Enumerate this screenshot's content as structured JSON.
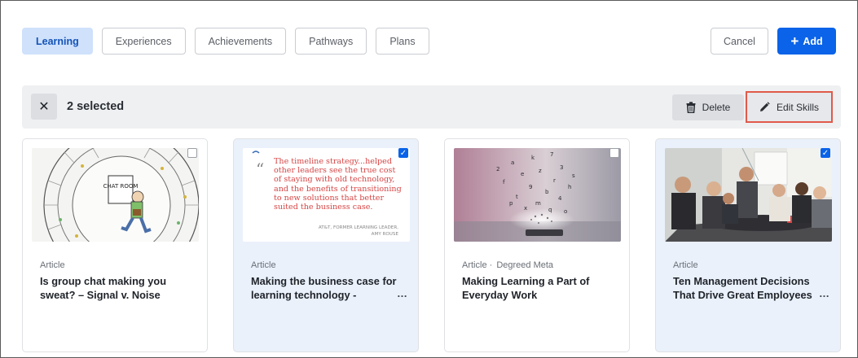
{
  "tabs": [
    {
      "label": "Learning",
      "active": true
    },
    {
      "label": "Experiences",
      "active": false
    },
    {
      "label": "Achievements",
      "active": false
    },
    {
      "label": "Pathways",
      "active": false
    },
    {
      "label": "Plans",
      "active": false
    }
  ],
  "header_actions": {
    "cancel_label": "Cancel",
    "add_label": "Add"
  },
  "selection_bar": {
    "count_text": "2 selected",
    "delete_label": "Delete",
    "edit_skills_label": "Edit Skills"
  },
  "cards": [
    {
      "type": "Article",
      "source": "",
      "title": "Is group chat making you sweat? – Signal v. Noise",
      "selected": false,
      "thumbnail": "chat-room-cartoon",
      "thumb_text": "CHAT ROOM",
      "has_more": false
    },
    {
      "type": "Article",
      "source": "",
      "title": "Making the business case for learning technology -",
      "selected": true,
      "thumbnail": "quote-graphic",
      "quote": "The timeline strategy...helped other leaders see the true cost of staying with old technology, and the benefits of transitioning to new solutions that better suited the business case.",
      "attribution_line1": "AT&T, FORMER LEARNING LEADER,",
      "attribution_line2": "AMY ROUSE",
      "has_more": true
    },
    {
      "type": "Article ·",
      "source": "Degreed Meta",
      "title": "Making Learning a Part of Everyday Work",
      "selected": false,
      "thumbnail": "phone-letters-photo",
      "has_more": false
    },
    {
      "type": "Article",
      "source": "",
      "title": "Ten Management Decisions That Drive Great Employees",
      "selected": true,
      "thumbnail": "office-meeting-photo",
      "has_more": true
    }
  ],
  "icons": {
    "close": "close-icon",
    "delete": "trash-icon",
    "edit": "pencil-icon",
    "add": "plus-icon",
    "check": "checkmark-icon"
  },
  "colors": {
    "primary": "#0a63e8",
    "active_tab_bg": "#cfe1fb",
    "selected_card_bg": "#eaf1fb",
    "highlight_border": "#e05a4a",
    "quote_text": "#d64545"
  }
}
